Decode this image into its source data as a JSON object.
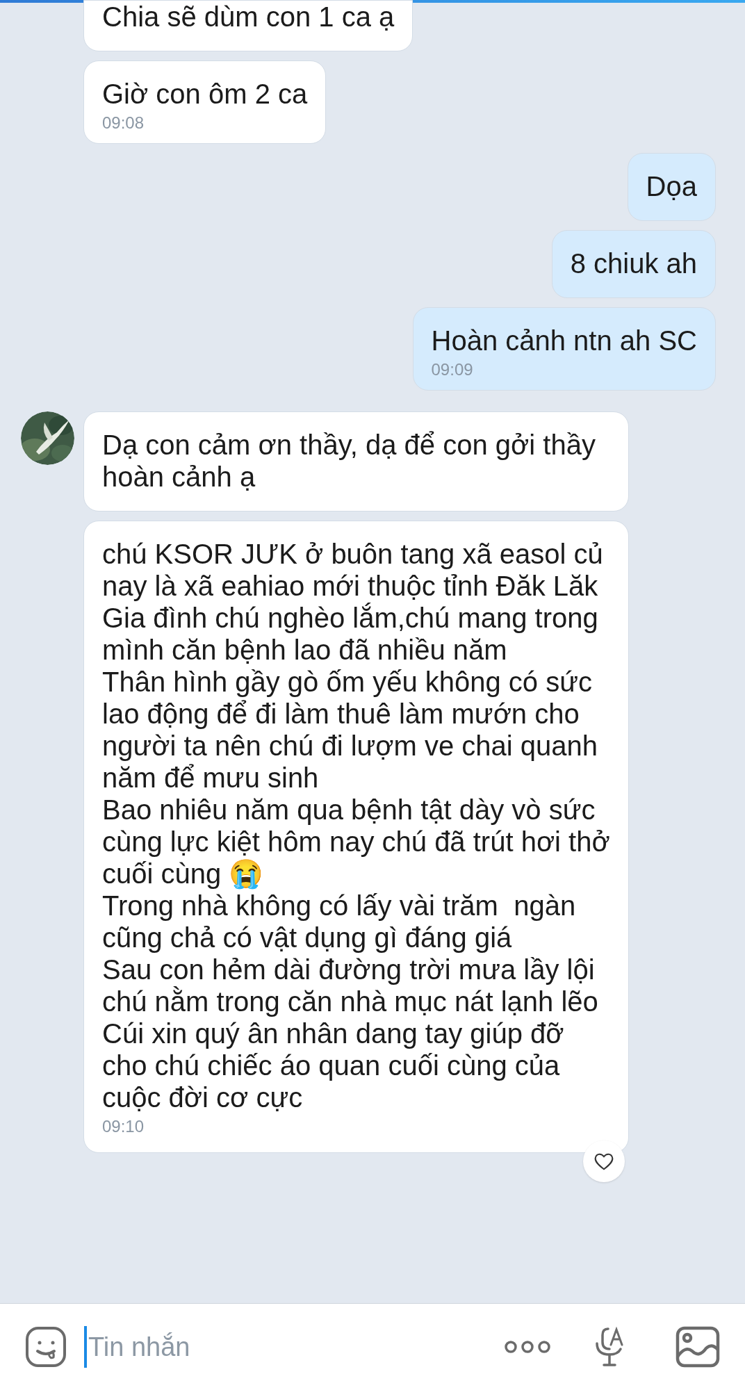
{
  "messages": [
    {
      "kind": "incoming",
      "text": "Chia sẽ dùm con 1 ca ạ",
      "clipped_top": true,
      "avatar": false
    },
    {
      "kind": "incoming",
      "text": "Giờ con ôm 2 ca",
      "time": "09:08",
      "clipped_top": false,
      "avatar": false
    },
    {
      "kind": "outgoing",
      "text": "Dọa",
      "clipped_top": false,
      "avatar": false
    },
    {
      "kind": "outgoing",
      "text": "8 chiuk ah",
      "clipped_top": false,
      "avatar": false
    },
    {
      "kind": "outgoing",
      "text": "Hoàn cảnh ntn ah SC",
      "time": "09:09",
      "clipped_top": false,
      "avatar": false
    },
    {
      "kind": "incoming",
      "text": "Dạ con cảm ơn thầy, dạ để con gởi thầy hoàn cảnh ạ",
      "clipped_top": false,
      "avatar": true
    },
    {
      "kind": "incoming",
      "text": "chú KSOR JƯK ở buôn tang xã easol củ nay là xã eahiao mới thuộc tỉnh Đăk Lăk\nGia đình chú nghèo lắm,chú mang trong mình căn bệnh lao đã nhiều năm\nThân hình gầy gò ốm yếu không có sức lao động để đi làm thuê làm mướn cho người ta nên chú đi lượm ve chai quanh năm để mưu sinh\nBao nhiêu năm qua bệnh tật dày vò sức cùng lực kiệt hôm nay chú đã trút hơi thở cuối cùng 😭\nTrong nhà không có lấy vài trăm  ngàn cũng chả có vật dụng gì đáng giá\nSau con hẻm dài đường trời mưa lầy lội chú nằm trong căn nhà mục nát lạnh lẽo\nCúi xin quý ân nhân dang tay giúp đỡ cho chú chiếc áo quan cuối cùng của cuộc đời cơ cực",
      "time": "09:10",
      "clipped_top": false,
      "avatar": false,
      "liked": true
    }
  ],
  "composer": {
    "placeholder": "Tin nhắn"
  }
}
